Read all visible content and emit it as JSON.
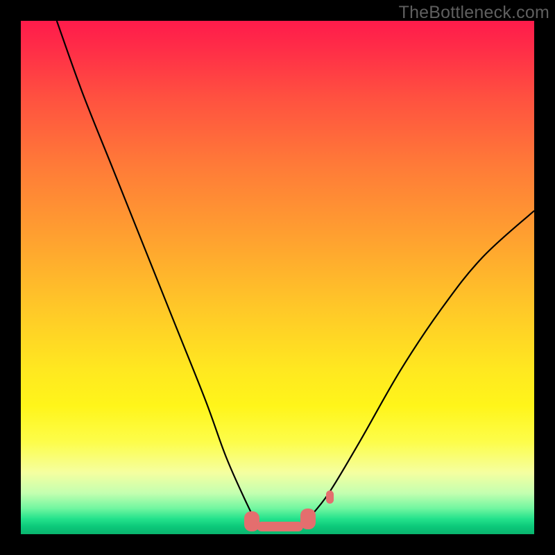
{
  "watermark": "TheBottleneck.com",
  "colors": {
    "frame": "#000000",
    "gradient_top": "#ff1b4b",
    "gradient_mid": "#ffe820",
    "gradient_bottom": "#09b46e",
    "curve": "#000000",
    "marker": "#e46e6e"
  },
  "chart_data": {
    "type": "line",
    "title": "",
    "xlabel": "",
    "ylabel": "",
    "xlim": [
      0,
      100
    ],
    "ylim": [
      0,
      100
    ],
    "grid": false,
    "legend": false,
    "series": [
      {
        "name": "left-curve",
        "x": [
          7,
          12,
          18,
          24,
          30,
          36,
          40,
          44,
          46
        ],
        "y": [
          100,
          86,
          71,
          56,
          41,
          26,
          15,
          6,
          2
        ]
      },
      {
        "name": "right-curve",
        "x": [
          56,
          60,
          66,
          74,
          82,
          90,
          100
        ],
        "y": [
          3,
          8,
          18,
          32,
          44,
          54,
          63
        ]
      }
    ],
    "markers": [
      {
        "name": "valley-left-blob",
        "x_range": [
          43.5,
          46.5
        ],
        "y_range": [
          0.5,
          4.5
        ]
      },
      {
        "name": "valley-floor-blob",
        "x_range": [
          46,
          55
        ],
        "y_range": [
          0.5,
          2.5
        ]
      },
      {
        "name": "valley-right-blob",
        "x_range": [
          54.5,
          57.5
        ],
        "y_range": [
          1.0,
          5.0
        ]
      },
      {
        "name": "detached-dot",
        "x_range": [
          59.5,
          61
        ],
        "y_range": [
          6.0,
          8.5
        ]
      }
    ],
    "annotations": [
      {
        "text": "TheBottleneck.com",
        "position": "top-right"
      }
    ]
  }
}
